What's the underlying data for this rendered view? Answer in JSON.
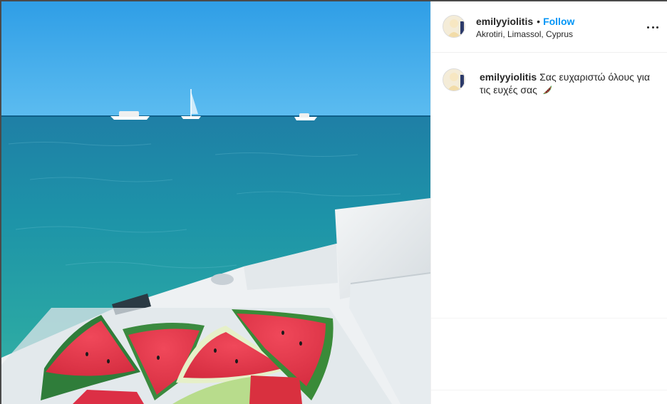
{
  "post": {
    "username": "emilyyiolitis",
    "follow_label": "Follow",
    "separator": "•",
    "location": "Akrotiri, Limassol, Cyprus",
    "more_icon": "more-options-icon",
    "image_icon": "post-photo"
  },
  "caption": {
    "username": "emilyyiolitis",
    "text": "Σας ευχαριστώ όλους για τις ευχές σας",
    "emoji": "watermelon-icon"
  },
  "colors": {
    "follow": "#0095f6",
    "text": "#262626",
    "border": "#efefef"
  }
}
